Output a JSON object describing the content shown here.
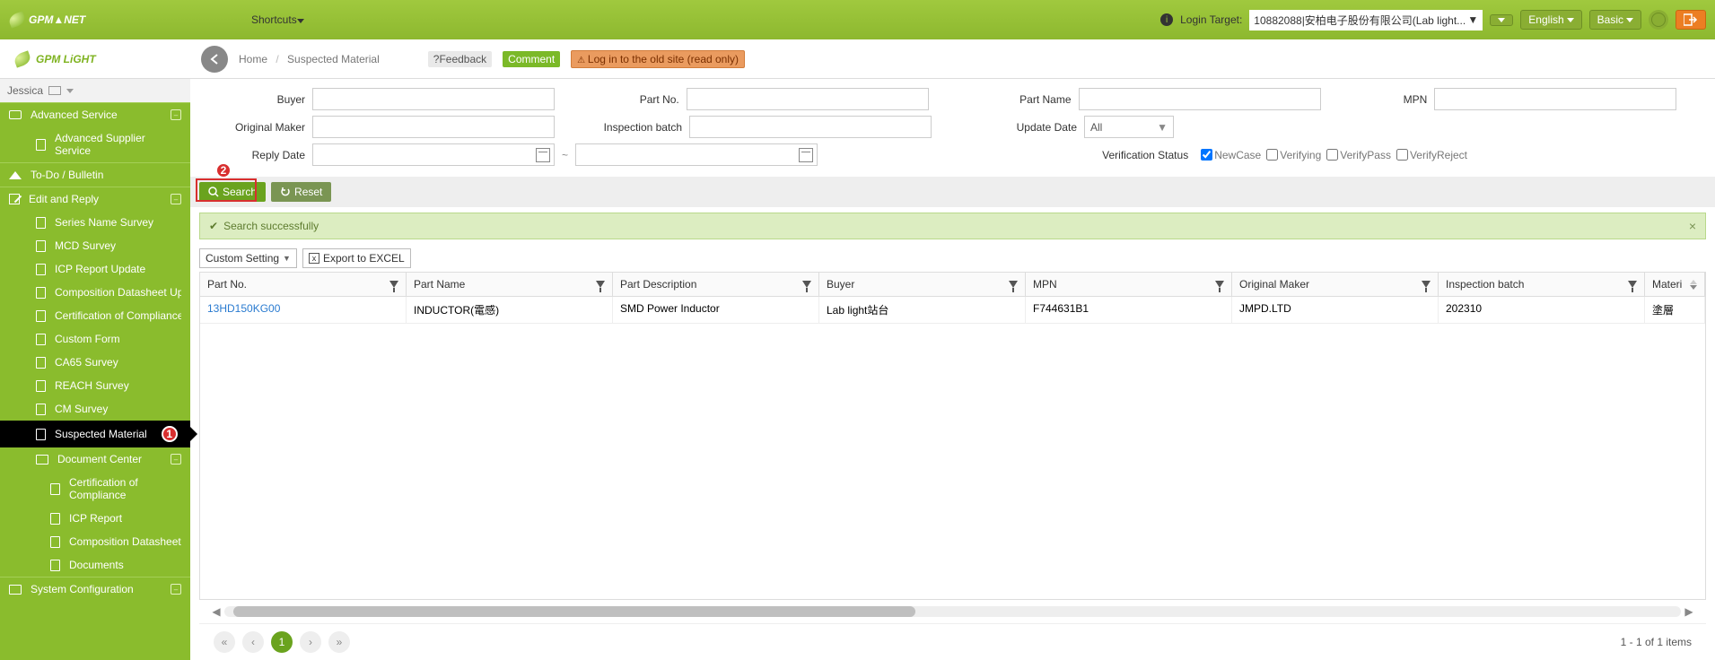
{
  "top": {
    "logo": "GPM▲NET",
    "shortcuts": "Shortcuts",
    "login_label": "Login Target:",
    "login_value": "10882088|安柏电子股份有限公司(Lab light...",
    "lang": "English",
    "mode": "Basic"
  },
  "second": {
    "logo": "GPM LiGHT",
    "crumb_home": "Home",
    "crumb_page": "Suspected Material",
    "tag_feedback": "?Feedback",
    "tag_comment": "Comment",
    "tag_oldsite": "Log in to the old site (read only)"
  },
  "user": {
    "name": "Jessica"
  },
  "sidebar": {
    "adv": "Advanced Service",
    "adv_sup": "Advanced Supplier Service",
    "todo": "To-Do / Bulletin",
    "edit": "Edit and Reply",
    "series": "Series Name Survey",
    "mcd": "MCD Survey",
    "icp": "ICP Report Update",
    "cds": "Composition Datasheet Update",
    "coc": "Certification of Compliance Update",
    "custom": "Custom Form",
    "ca65": "CA65 Survey",
    "reach": "REACH Survey",
    "cm": "CM Survey",
    "susp": "Suspected Material",
    "dcenter": "Document Center",
    "d_coc": "Certification of Compliance",
    "d_icp": "ICP Report",
    "d_cds": "Composition Datasheet",
    "d_docs": "Documents",
    "sysconf": "System Configuration"
  },
  "form": {
    "buyer": "Buyer",
    "partno": "Part No.",
    "partname": "Part Name",
    "mpn": "MPN",
    "omaker": "Original Maker",
    "ibatch": "Inspection batch",
    "udate": "Update Date",
    "udate_val": "All",
    "rdate": "Reply Date",
    "vstat": "Verification Status",
    "v_new": "NewCase",
    "v_ing": "Verifying",
    "v_pass": "VerifyPass",
    "v_rej": "VerifyReject"
  },
  "actions": {
    "search": "Search",
    "reset": "Reset"
  },
  "msg": {
    "text": "Search successfully"
  },
  "gridbar": {
    "custom": "Custom Setting",
    "excel": "Export to EXCEL"
  },
  "grid": {
    "cols": {
      "partno": "Part No.",
      "partname": "Part Name",
      "pdesc": "Part Description",
      "buyer": "Buyer",
      "mpn": "MPN",
      "omaker": "Original Maker",
      "ibatch": "Inspection batch",
      "mat": "Materi"
    },
    "row": {
      "partno": "13HD150KG00",
      "partname": "INDUCTOR(電感)",
      "pdesc": "SMD Power Inductor",
      "buyer": "Lab light站台",
      "mpn": "F744631B1",
      "omaker": "JMPD.LTD",
      "ibatch": "202310",
      "mat": "塗層"
    }
  },
  "pager": {
    "cur": "1",
    "info": "1 - 1 of 1 items"
  },
  "badges": {
    "b1": "1",
    "b2": "2"
  }
}
